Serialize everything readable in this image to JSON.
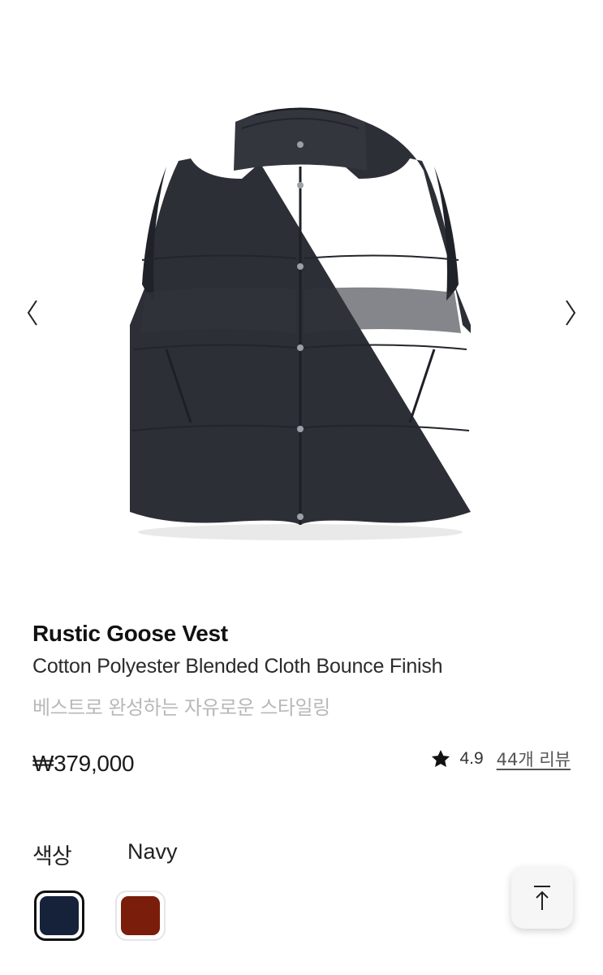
{
  "carousel": {
    "image_icon": "product-photo-puffer-vest",
    "prev_icon": "chevron-left-icon",
    "next_icon": "chevron-right-icon"
  },
  "product": {
    "title": "Rustic Goose Vest",
    "subtitle": "Cotton Polyester Blended Cloth Bounce Finish",
    "tagline": "베스트로 완성하는 자유로운 스타일링",
    "price": "₩379,000",
    "rating": "4.9",
    "reviews_link": "44개 리뷰"
  },
  "color": {
    "label": "색상",
    "selected": "Navy",
    "swatches": [
      {
        "name": "Navy",
        "hex": "#16213a",
        "selected": true
      },
      {
        "name": "Brown",
        "hex": "#7a1d0a",
        "selected": false
      }
    ]
  },
  "scroll_top": {
    "icon": "arrow-up-to-top-icon"
  },
  "colors": {
    "vest_body": "#2c2f36",
    "tagline_gray": "#b8b8b8"
  }
}
